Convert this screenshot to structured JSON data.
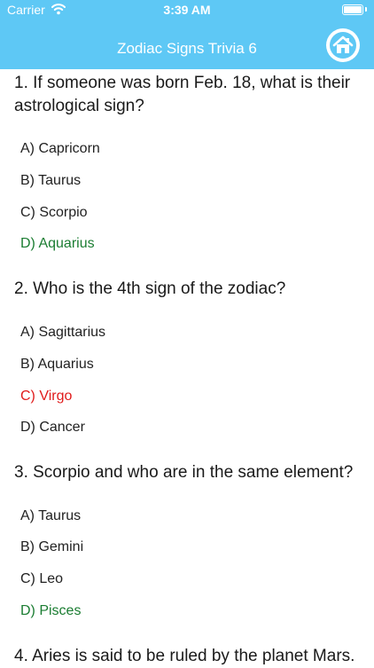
{
  "status_bar": {
    "carrier": "Carrier",
    "time": "3:39 AM"
  },
  "nav": {
    "title": "Zodiac Signs Trivia 6",
    "home_icon": "home-icon"
  },
  "colors": {
    "header": "#5ec8f5",
    "correct": "#1b7d32",
    "wrong": "#e01b1b"
  },
  "questions": [
    {
      "text": "1. If someone was born Feb. 18, what is their astrological sign?",
      "options": [
        {
          "label": "A) Capricorn",
          "state": "normal"
        },
        {
          "label": "B) Taurus",
          "state": "normal"
        },
        {
          "label": "C) Scorpio",
          "state": "normal"
        },
        {
          "label": "D) Aquarius",
          "state": "correct"
        }
      ]
    },
    {
      "text": "2. Who is the 4th sign of the zodiac?",
      "options": [
        {
          "label": "A) Sagittarius",
          "state": "normal"
        },
        {
          "label": "B) Aquarius",
          "state": "normal"
        },
        {
          "label": "C) Virgo",
          "state": "wrong"
        },
        {
          "label": "D) Cancer",
          "state": "normal"
        }
      ]
    },
    {
      "text": "3. Scorpio and who are in the same element?",
      "options": [
        {
          "label": "A) Taurus",
          "state": "normal"
        },
        {
          "label": "B) Gemini",
          "state": "normal"
        },
        {
          "label": "C) Leo",
          "state": "normal"
        },
        {
          "label": "D) Pisces",
          "state": "correct"
        }
      ]
    },
    {
      "text": "4. Aries is said to be ruled by the planet Mars."
    }
  ]
}
